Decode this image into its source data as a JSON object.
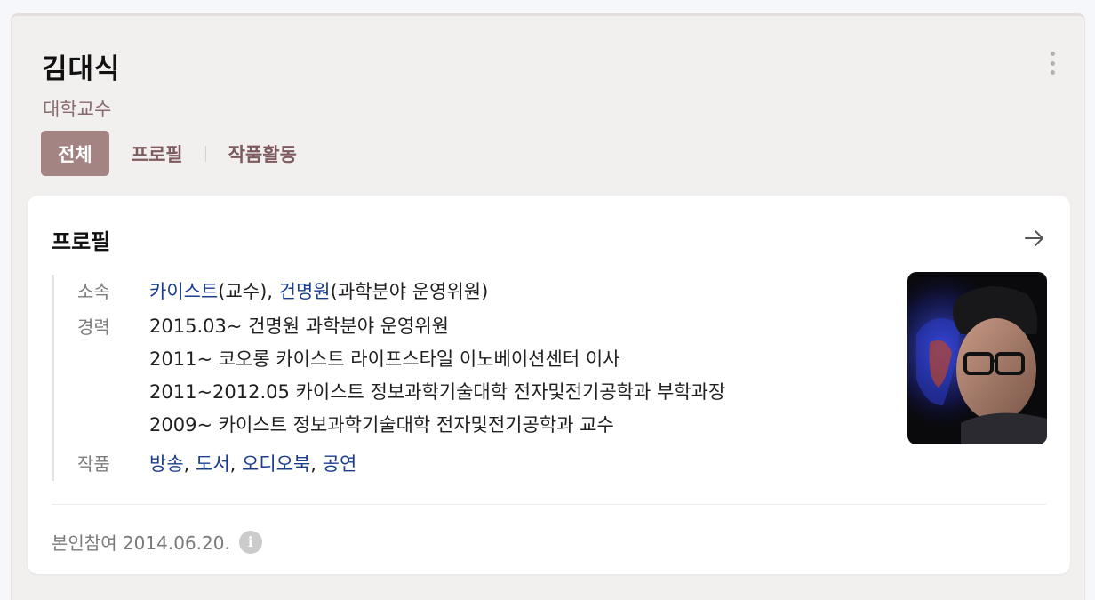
{
  "person": {
    "name": "김대식",
    "occupation": "대학교수"
  },
  "tabs": [
    {
      "label": "전체",
      "active": true
    },
    {
      "label": "프로필",
      "active": false
    },
    {
      "label": "작품활동",
      "active": false
    }
  ],
  "profile_card": {
    "title": "프로필",
    "affiliation": {
      "label": "소속",
      "org1": "카이스트",
      "org1_role": "(교수), ",
      "org2": "건명원",
      "org2_role": "(과학분야 운영위원)"
    },
    "career": {
      "label": "경력",
      "items": [
        "2015.03~ 건명원 과학분야 운영위원",
        "2011~ 코오롱 카이스트 라이프스타일 이노베이션센터 이사",
        "2011~2012.05 카이스트 정보과학기술대학 전자및전기공학과 부학과장",
        "2009~ 카이스트 정보과학기술대학 전자및전기공학과 교수"
      ]
    },
    "works": {
      "label": "작품",
      "items": [
        "방송",
        "도서",
        "오디오북",
        "공연"
      ],
      "separator": ", "
    },
    "footer": {
      "text": "본인참여 2014.06.20.",
      "info_icon": "i"
    }
  },
  "colors": {
    "accent": "#a38483",
    "link": "#1b3d8f",
    "subtitle": "#8a6a6e"
  },
  "icons": {
    "more": "more-vertical-icon",
    "arrow": "arrow-right-icon",
    "info": "info-icon"
  }
}
